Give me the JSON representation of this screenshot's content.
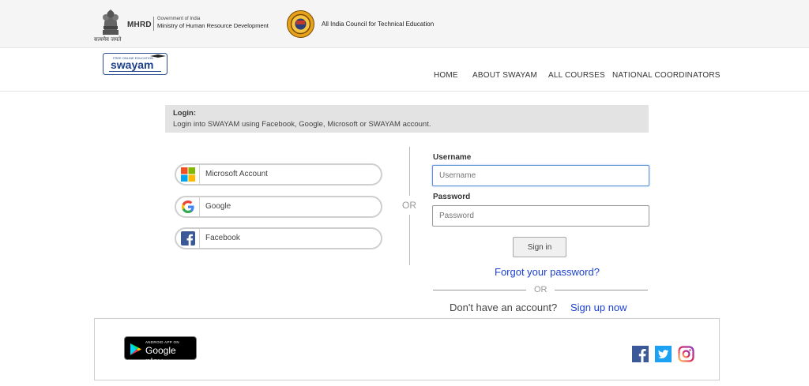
{
  "header": {
    "emblem_caption": "सत्यमेव जयते",
    "mhrd": "MHRD",
    "gov_line1": "Government of India",
    "gov_line2": "Ministry of Human Resource Development",
    "aicte": "All India Council for Technical Education"
  },
  "nav": {
    "home": "HOME",
    "about": "ABOUT SWAYAM",
    "courses": "ALL COURSES",
    "coordinators": "NATIONAL COORDINATORS"
  },
  "logo": {
    "tagline": "FREE ONLINE EDUCATION",
    "name": "swayam"
  },
  "login_banner": {
    "title": "Login:",
    "subtitle": "Login into SWAYAM using Facebook, Google, Microsoft or SWAYAM account."
  },
  "social": {
    "microsoft": "Microsoft Account",
    "google": "Google",
    "facebook": "Facebook"
  },
  "divider_or": "OR",
  "form": {
    "username_label": "Username",
    "username_placeholder": "Username",
    "password_label": "Password",
    "password_placeholder": "Password",
    "signin": "Sign in",
    "forgot": "Forgot your password?",
    "or": "OR",
    "no_account": "Don't have an account?",
    "signup": "Sign up now"
  },
  "footer": {
    "gplay_small": "ANDROID APP ON",
    "gplay_big": "Google play"
  },
  "colors": {
    "link": "#1a3fd1",
    "facebook": "#3b5998",
    "twitter": "#1da1f2",
    "instagram": "#d6249f"
  }
}
